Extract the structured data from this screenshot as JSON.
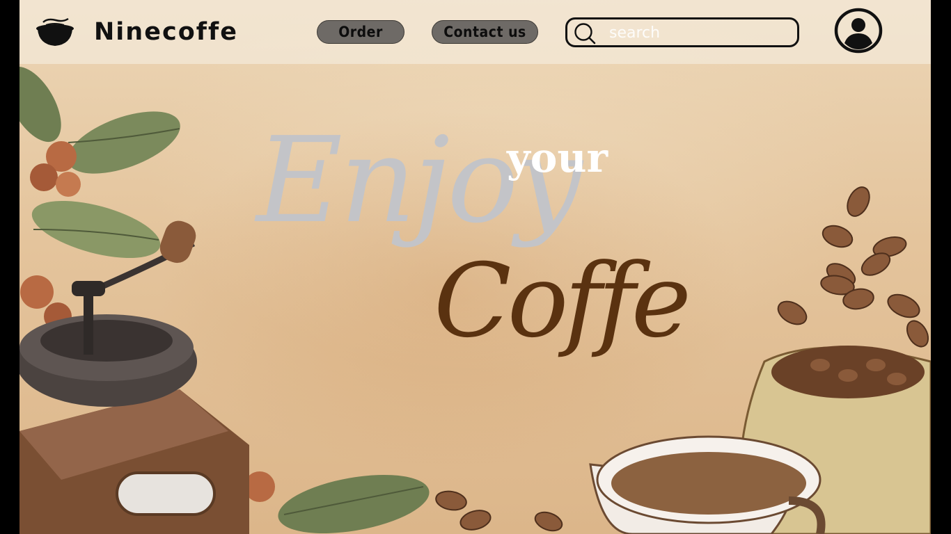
{
  "brand": {
    "name": "Ninecoffe"
  },
  "nav": {
    "order_label": "Order",
    "contact_label": "Contact us"
  },
  "search": {
    "placeholder": "search",
    "value": ""
  },
  "hero": {
    "line1": "Enjoy",
    "line2": "your",
    "line3": "Coffe"
  },
  "icons": {
    "logo": "coffee-cup-icon",
    "search": "search-icon",
    "user": "user-icon"
  },
  "colors": {
    "background": "#e4c49c",
    "nav_button": "#6e6a66",
    "enjoy_text": "#c3c4c8",
    "coffe_text": "#5a3210"
  }
}
